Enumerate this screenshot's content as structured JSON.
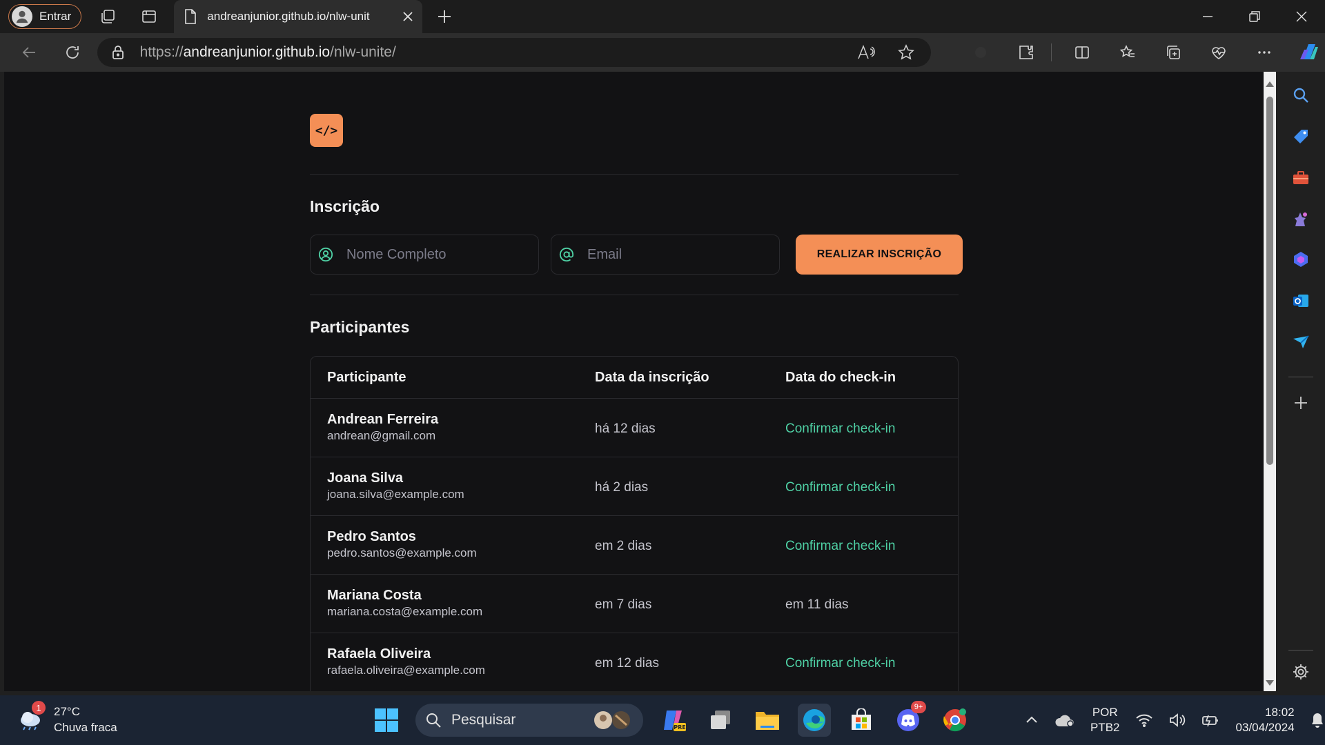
{
  "browser": {
    "profile_label": "Entrar",
    "tab_title": "andreanjunior.github.io/nlw-unit",
    "url_scheme": "https://",
    "url_host": "andreanjunior.github.io",
    "url_path": "/nlw-unite/"
  },
  "page": {
    "logo_text": "</>",
    "form_heading": "Inscrição",
    "name_placeholder": "Nome Completo",
    "email_placeholder": "Email",
    "submit_label": "REALIZAR INSCRIÇÃO",
    "participants_heading": "Participantes",
    "table": {
      "headers": [
        "Participante",
        "Data da inscrição",
        "Data do check-in"
      ],
      "rows": [
        {
          "name": "Andrean Ferreira",
          "email": "andrean@gmail.com",
          "registered": "há 12 dias",
          "checkin": "Confirmar check-in",
          "checked_in": false
        },
        {
          "name": "Joana Silva",
          "email": "joana.silva@example.com",
          "registered": "há 2 dias",
          "checkin": "Confirmar check-in",
          "checked_in": false
        },
        {
          "name": "Pedro Santos",
          "email": "pedro.santos@example.com",
          "registered": "em 2 dias",
          "checkin": "Confirmar check-in",
          "checked_in": false
        },
        {
          "name": "Mariana Costa",
          "email": "mariana.costa@example.com",
          "registered": "em 7 dias",
          "checkin": "em 11 dias",
          "checked_in": true
        },
        {
          "name": "Rafaela Oliveira",
          "email": "rafaela.oliveira@example.com",
          "registered": "em 12 dias",
          "checkin": "Confirmar check-in",
          "checked_in": false
        }
      ]
    }
  },
  "taskbar": {
    "weather_badge": "1",
    "temperature": "27°C",
    "weather_desc": "Chuva fraca",
    "search_label": "Pesquisar",
    "discord_badge": "9+",
    "lang_line1": "POR",
    "lang_line2": "PTB2",
    "time": "18:02",
    "date": "03/04/2024"
  },
  "colors": {
    "accent": "#f48f56",
    "link_green": "#4fd1a5",
    "page_bg": "#121214",
    "border": "#2a2a2e"
  }
}
